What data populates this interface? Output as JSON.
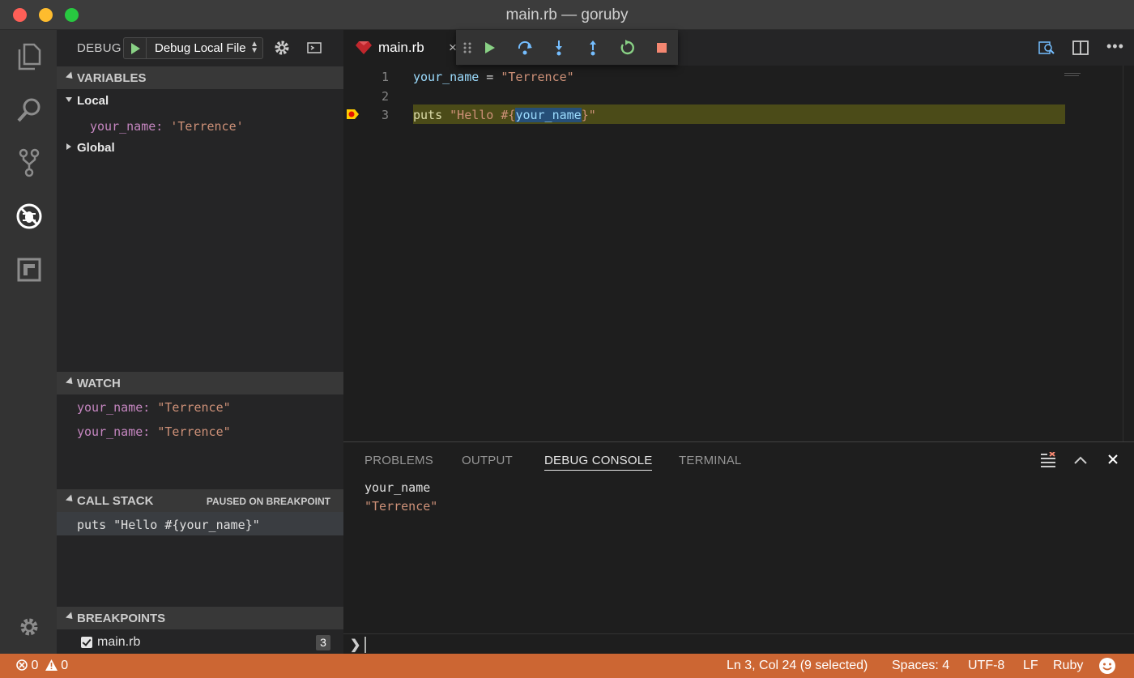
{
  "window": {
    "title": "main.rb — goruby"
  },
  "activity_bar": {
    "icons": [
      "files-icon",
      "search-icon",
      "source-control-icon",
      "debug-icon",
      "extensions-icon",
      "settings-gear-icon"
    ]
  },
  "debug": {
    "label": "DEBUG",
    "config": "Debug Local File"
  },
  "variables": {
    "header": "VARIABLES",
    "local_label": "Local",
    "local_items": [
      {
        "name": "your_name:",
        "value": "'Terrence'"
      }
    ],
    "global_label": "Global"
  },
  "watch": {
    "header": "WATCH",
    "items": [
      {
        "name": "your_name:",
        "value": "\"Terrence\""
      },
      {
        "name": "your_name:",
        "value": "\"Terrence\""
      }
    ]
  },
  "call_stack": {
    "header": "CALL STACK",
    "status": "PAUSED ON BREAKPOINT",
    "frame": "puts \"Hello #{your_name}\""
  },
  "breakpoints": {
    "header": "BREAKPOINTS",
    "file": "main.rb",
    "count": "3"
  },
  "editor": {
    "tab_label": "main.rb",
    "tab_close": "×",
    "line_numbers": [
      "1",
      "2",
      "3"
    ],
    "line1": {
      "var": "your_name",
      "op": " = ",
      "str": "\"Terrence\""
    },
    "line3": {
      "fn": "puts",
      "space": " ",
      "str_open": "\"Hello #{",
      "sel": "your_name",
      "str_close": "}\""
    }
  },
  "debug_toolbar": {
    "buttons": [
      "drag-handle-icon",
      "continue-icon",
      "step-over-icon",
      "step-into-icon",
      "step-out-icon",
      "restart-icon",
      "stop-icon"
    ]
  },
  "panel": {
    "tabs": [
      "PROBLEMS",
      "OUTPUT",
      "DEBUG CONSOLE",
      "TERMINAL"
    ],
    "active_tab": "DEBUG CONSOLE",
    "console_lines": [
      "your_name",
      "\"Terrence\""
    ],
    "prompt": "❯"
  },
  "status_bar": {
    "errors": "0",
    "warnings": "0",
    "position": "Ln 3, Col 24 (9 selected)",
    "spaces": "Spaces: 4",
    "encoding": "UTF-8",
    "eol": "LF",
    "language": "Ruby",
    "color": "#cc6633"
  }
}
